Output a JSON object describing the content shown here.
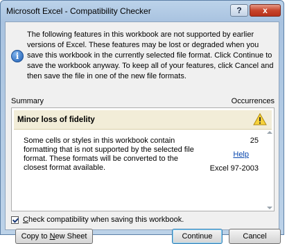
{
  "window": {
    "title": "Microsoft Excel - Compatibility Checker",
    "help_glyph": "?",
    "close_glyph": "x"
  },
  "intro_text": "The following features in this workbook are not supported by earlier versions of Excel. These features may be lost or degraded when you save this workbook in the currently selected file format. Click Continue to save the workbook anyway. To keep all of your features, click Cancel and then save the file in one of the new file formats.",
  "summary_label": "Summary",
  "occurrences_label": "Occurrences",
  "issue": {
    "title": "Minor loss of fidelity",
    "description": "Some cells or styles in this workbook contain formatting that is not supported by the selected file format. These formats will be converted to the closest format available.",
    "count": "25",
    "help_link": "Help",
    "format": "Excel 97-2003"
  },
  "checkbox": {
    "label_prefix": "C",
    "label_rest": "heck compatibility when saving this workbook.",
    "checked": true
  },
  "buttons": {
    "copy_prefix": "Copy to ",
    "copy_accel": "N",
    "copy_rest": "ew Sheet",
    "continue_label": "Continue",
    "cancel_label": "Cancel"
  },
  "icons": {
    "info": "info-icon",
    "warning": "warning-icon"
  },
  "colors": {
    "title_gradient": "#bcd3ea",
    "close_button": "#c7452c",
    "issue_header_bg": "#f2edd8",
    "warning_yellow": "#f7d23a",
    "link": "#0645ad"
  }
}
